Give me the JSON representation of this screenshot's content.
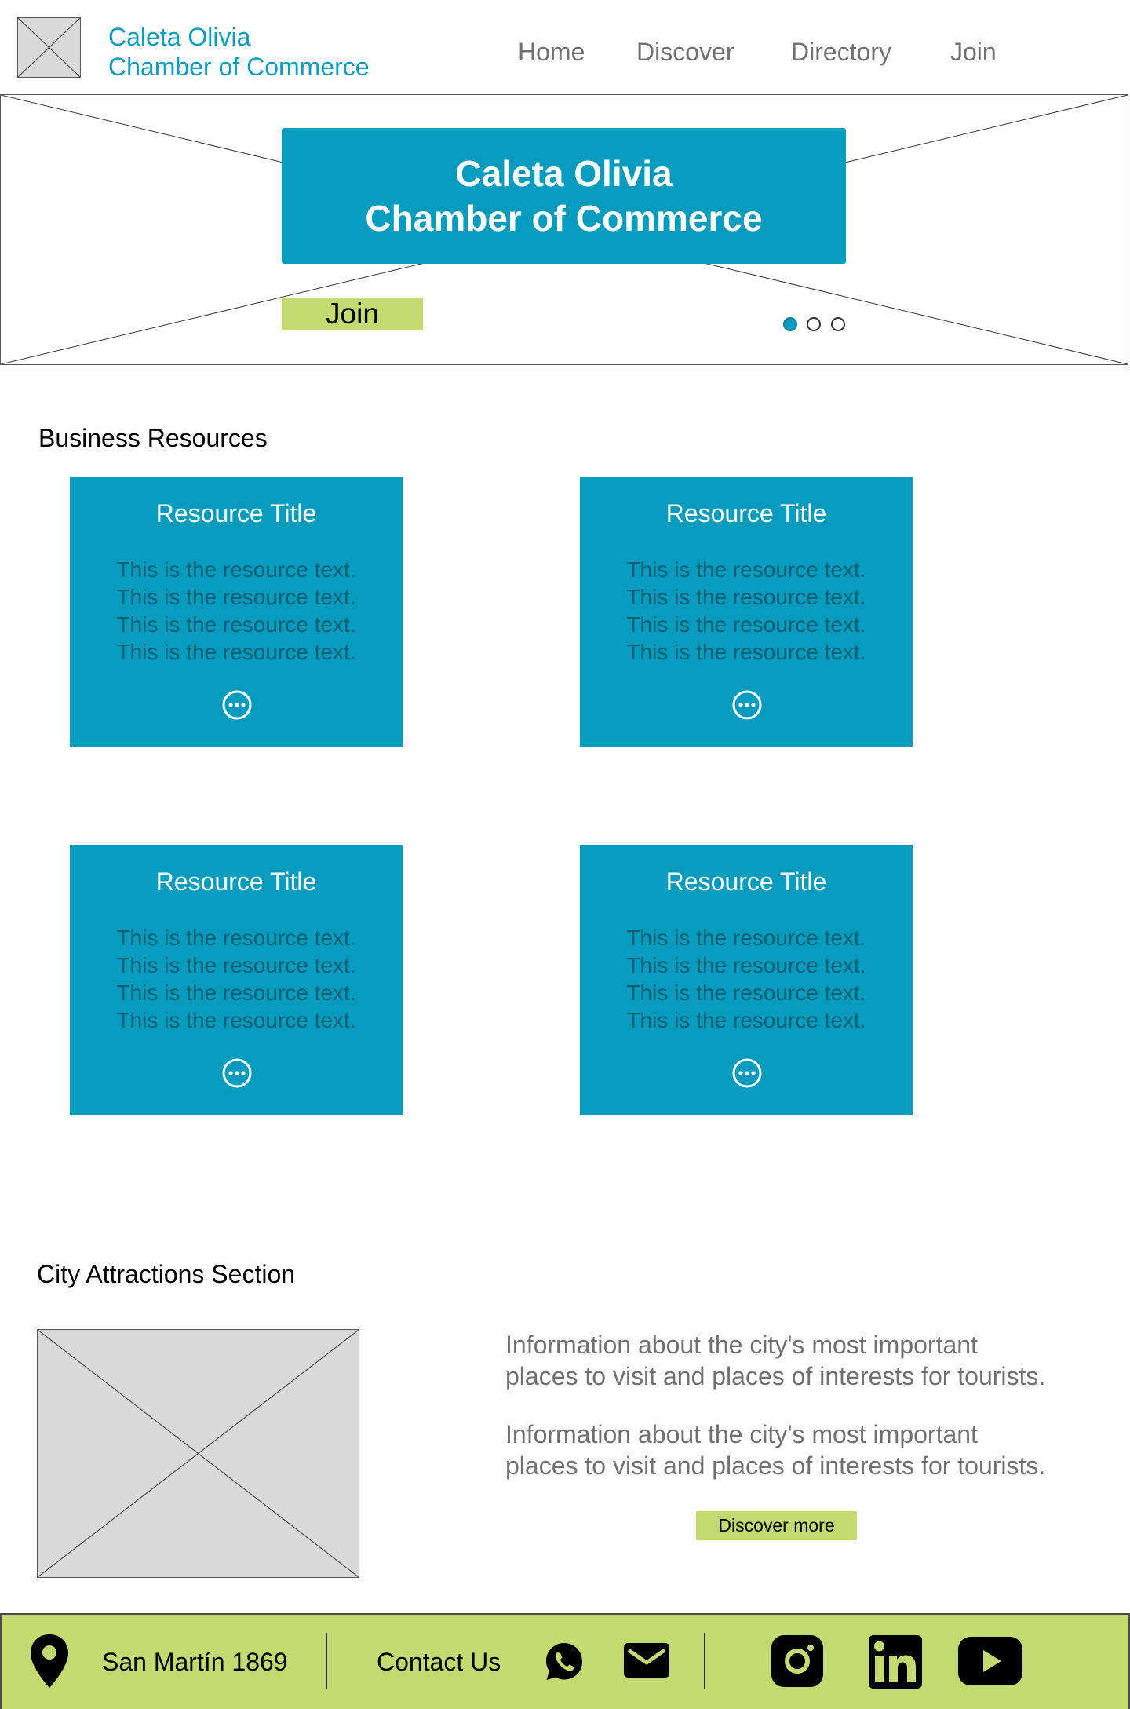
{
  "header": {
    "brand_line1": "Caleta Olivia",
    "brand_line2": "Chamber of Commerce",
    "nav": [
      "Home",
      "Discover",
      "Directory",
      "Join"
    ]
  },
  "hero": {
    "title_line1": "Caleta Olivia",
    "title_line2": "Chamber of Commerce",
    "join_label": "Join",
    "slides": 3,
    "active_slide": 1
  },
  "business_resources": {
    "title": "Business Resources",
    "cards": [
      {
        "title": "Resource Title",
        "lines": [
          "This is the resource text.",
          "This is the resource text.",
          "This is the resource text.",
          "This is the resource text."
        ]
      },
      {
        "title": "Resource Title",
        "lines": [
          "This is the resource text.",
          "This is the resource text.",
          "This is the resource text.",
          "This is the resource text."
        ]
      },
      {
        "title": "Resource Title",
        "lines": [
          "This is the resource text.",
          "This is the resource text.",
          "This is the resource text.",
          "This is the resource text."
        ]
      },
      {
        "title": "Resource Title",
        "lines": [
          "This is the resource text.",
          "This is the resource text.",
          "This is the resource text.",
          "This is the resource text."
        ]
      }
    ]
  },
  "attractions": {
    "title": "City Attractions Section",
    "para1_line1": "Information about the city's most important",
    "para1_line2": "places to visit and places of interests for tourists.",
    "para2_line1": "Information about the city's most important",
    "para2_line2": "places to visit and places of interests for tourists.",
    "button_label": "Discover more"
  },
  "footer": {
    "address": "San Martín 1869",
    "contact": "Contact Us",
    "icons": [
      "location-pin-icon",
      "whatsapp-icon",
      "mail-icon",
      "instagram-icon",
      "linkedin-icon",
      "youtube-icon"
    ]
  },
  "colors": {
    "primary": "#079bbe",
    "accent": "#c2da6f",
    "placeholder": "#d9d9d9"
  }
}
